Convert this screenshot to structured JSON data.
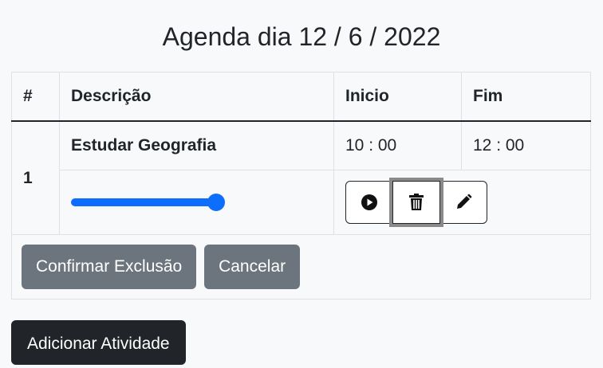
{
  "header": {
    "title": "Agenda dia 12 / 6 / 2022"
  },
  "table": {
    "columns": [
      "#",
      "Descrição",
      "Inicio",
      "Fim"
    ],
    "rows": [
      {
        "index": "1",
        "description": "Estudar Geografia",
        "start": "10 : 00",
        "end": "12 : 00",
        "progress": 1.0
      }
    ]
  },
  "actions": {
    "play_icon": "play-circle-icon",
    "delete_icon": "trash-icon",
    "edit_icon": "pencil-icon"
  },
  "confirm": {
    "confirm_label": "Confirmar Exclusão",
    "cancel_label": "Cancelar"
  },
  "footer": {
    "add_label": "Adicionar Atividade"
  },
  "colors": {
    "accent": "#0d6efd",
    "secondary": "#6c757d",
    "dark": "#212529"
  }
}
